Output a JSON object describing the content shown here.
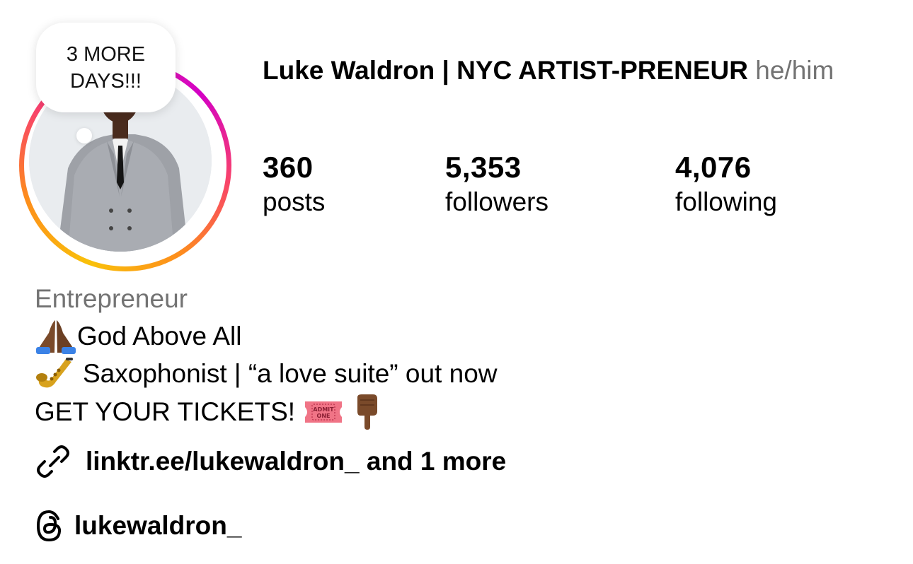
{
  "note": {
    "text": "3 MORE DAYS!!!"
  },
  "profile": {
    "display_name": "Luke Waldron | NYC ARTIST-PRENEUR",
    "pronouns": "he/him",
    "category": "Entrepreneur"
  },
  "stats": [
    {
      "value": "360",
      "label": "posts"
    },
    {
      "value": "5,353",
      "label": "followers"
    },
    {
      "value": "4,076",
      "label": "following"
    }
  ],
  "bio": {
    "line1": "God Above All",
    "line2": "Saxophonist | “a love suite” out now",
    "line3": "GET YOUR TICKETS!",
    "ticket_text_top": "ADMIT",
    "ticket_text_bottom": "ONE"
  },
  "link": {
    "text": "linktr.ee/lukewaldron_ and 1 more",
    "icon": "link-icon"
  },
  "threads": {
    "handle": "lukewaldron_",
    "icon": "threads-icon"
  },
  "colors": {
    "secondary_text": "#737373",
    "ring_gradient": [
      "#f9c10a",
      "#fd8d1c",
      "#f8416c",
      "#d300c5"
    ]
  }
}
